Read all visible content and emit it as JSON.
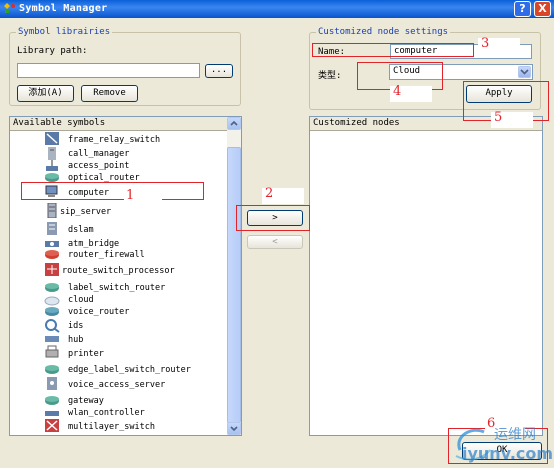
{
  "window": {
    "title": "Symbol Manager",
    "help_label": "?",
    "close_label": "X"
  },
  "libraries": {
    "group_title": "Symbol librairies",
    "path_label": "Library path:",
    "path_value": "",
    "browse_label": "...",
    "add_label": "添加(A)",
    "remove_label": "Remove"
  },
  "available": {
    "header": "Available symbols",
    "items": [
      "frame_relay_switch",
      "call_manager",
      "access_point",
      "optical_router",
      "computer",
      "sip_server",
      "dslam",
      "atm_bridge",
      "router_firewall",
      "route_switch_processor",
      "label_switch_router",
      "cloud",
      "voice_router",
      "ids",
      "hub",
      "printer",
      "edge_label_switch_router",
      "voice_access_server",
      "gateway",
      "wlan_controller",
      "multilayer_switch"
    ]
  },
  "transfer": {
    "add_label": ">",
    "remove_label": "<"
  },
  "custom": {
    "group_title": "Customized node settings",
    "name_label": "Name:",
    "name_value": "computer",
    "type_label": "类型:",
    "type_value": "Cloud",
    "apply_label": "Apply",
    "nodes_header": "Customized nodes"
  },
  "ok_label": "OK",
  "annotations": [
    "1",
    "2",
    "3",
    "4",
    "5",
    "6"
  ],
  "watermark": {
    "cn": "运维网",
    "url": "iyunv.com"
  },
  "colors": {
    "annotation": "#e0242a",
    "titlebar": "#0a5fd8",
    "group_title": "#1a3fb0"
  }
}
